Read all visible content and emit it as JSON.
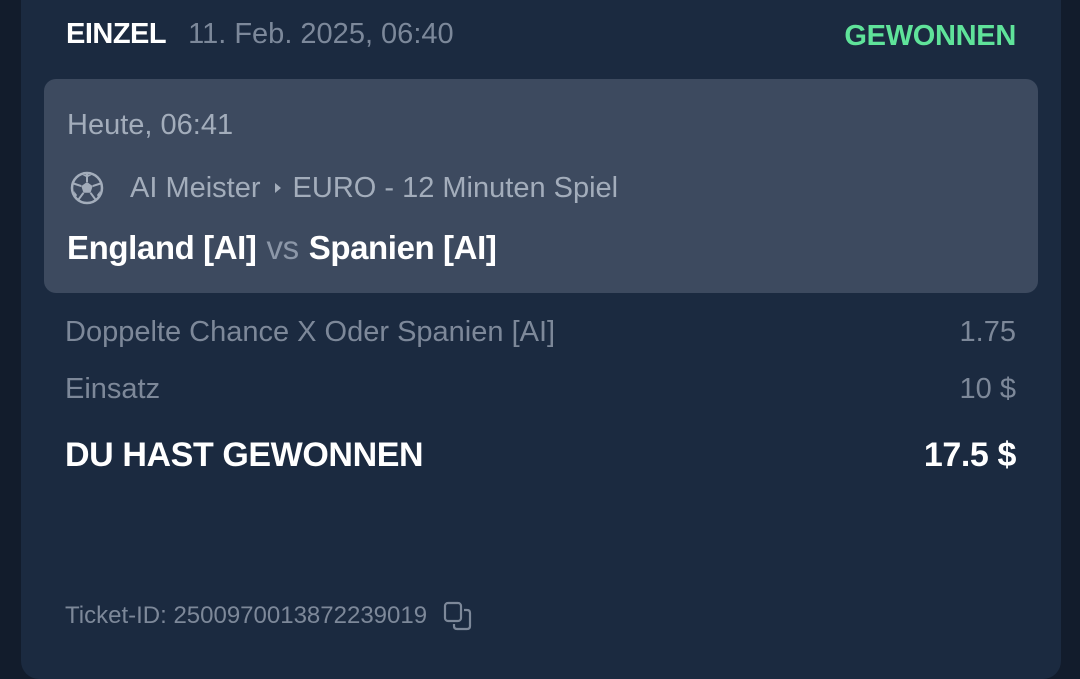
{
  "header": {
    "bet_type": "EINZEL",
    "date": "11. Feb. 2025, 06:40",
    "status": "GEWONNEN",
    "status_color": "#5fe39a"
  },
  "event": {
    "time": "Heute, 06:41",
    "sport_icon": "soccer-ball-icon",
    "league": "AI Meister",
    "competition": "EURO - 12 Minuten Spiel",
    "home_team": "England [AI]",
    "separator": "vs",
    "away_team": "Spanien [AI]"
  },
  "bet": {
    "selection": "Doppelte Chance X Oder Spanien [AI]",
    "odds": "1.75",
    "stake_label": "Einsatz",
    "stake_value": "10 $",
    "win_label": "DU HAST GEWONNEN",
    "win_value": "17.5 $"
  },
  "ticket": {
    "label": "Ticket-ID: 2500970013872239019",
    "copy_icon": "copy-icon"
  }
}
